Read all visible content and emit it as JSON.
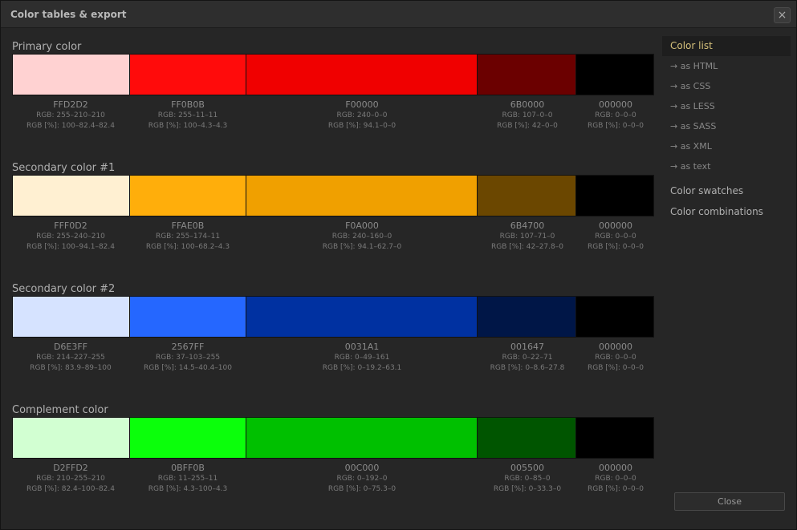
{
  "window": {
    "title": "Color tables & export",
    "close_icon": "×"
  },
  "sections": [
    {
      "title": "Primary color",
      "swatches": [
        {
          "color": "#FFD2D2",
          "hex": "FFD2D2",
          "rgb": "RGB: 255–210–210",
          "rgbp": "RGB [%]: 100–82.4–82.4"
        },
        {
          "color": "#FF0B0B",
          "hex": "FF0B0B",
          "rgb": "RGB: 255–11–11",
          "rgbp": "RGB [%]: 100–4.3–4.3"
        },
        {
          "color": "#F00000",
          "hex": "F00000",
          "rgb": "RGB: 240–0–0",
          "rgbp": "RGB [%]: 94.1–0–0"
        },
        {
          "color": "#6B0000",
          "hex": "6B0000",
          "rgb": "RGB: 107–0–0",
          "rgbp": "RGB [%]: 42–0–0"
        },
        {
          "color": "#000000",
          "hex": "000000",
          "rgb": "RGB: 0–0–0",
          "rgbp": "RGB [%]: 0–0–0"
        }
      ]
    },
    {
      "title": "Secondary color #1",
      "swatches": [
        {
          "color": "#FFF0D2",
          "hex": "FFF0D2",
          "rgb": "RGB: 255–240–210",
          "rgbp": "RGB [%]: 100–94.1–82.4"
        },
        {
          "color": "#FFAE0B",
          "hex": "FFAE0B",
          "rgb": "RGB: 255–174–11",
          "rgbp": "RGB [%]: 100–68.2–4.3"
        },
        {
          "color": "#F0A000",
          "hex": "F0A000",
          "rgb": "RGB: 240–160–0",
          "rgbp": "RGB [%]: 94.1–62.7–0"
        },
        {
          "color": "#6B4700",
          "hex": "6B4700",
          "rgb": "RGB: 107–71–0",
          "rgbp": "RGB [%]: 42–27.8–0"
        },
        {
          "color": "#000000",
          "hex": "000000",
          "rgb": "RGB: 0–0–0",
          "rgbp": "RGB [%]: 0–0–0"
        }
      ]
    },
    {
      "title": "Secondary color #2",
      "swatches": [
        {
          "color": "#D6E3FF",
          "hex": "D6E3FF",
          "rgb": "RGB: 214–227–255",
          "rgbp": "RGB [%]: 83.9–89–100"
        },
        {
          "color": "#2567FF",
          "hex": "2567FF",
          "rgb": "RGB: 37–103–255",
          "rgbp": "RGB [%]: 14.5–40.4–100"
        },
        {
          "color": "#0031A1",
          "hex": "0031A1",
          "rgb": "RGB: 0–49–161",
          "rgbp": "RGB [%]: 0–19.2–63.1"
        },
        {
          "color": "#001647",
          "hex": "001647",
          "rgb": "RGB: 0–22–71",
          "rgbp": "RGB [%]: 0–8.6–27.8"
        },
        {
          "color": "#000000",
          "hex": "000000",
          "rgb": "RGB: 0–0–0",
          "rgbp": "RGB [%]: 0–0–0"
        }
      ]
    },
    {
      "title": "Complement color",
      "swatches": [
        {
          "color": "#D2FFD2",
          "hex": "D2FFD2",
          "rgb": "RGB: 210–255–210",
          "rgbp": "RGB [%]: 82.4–100–82.4"
        },
        {
          "color": "#0BFF0B",
          "hex": "0BFF0B",
          "rgb": "RGB: 11–255–11",
          "rgbp": "RGB [%]: 4.3–100–4.3"
        },
        {
          "color": "#00C000",
          "hex": "00C000",
          "rgb": "RGB: 0–192–0",
          "rgbp": "RGB [%]: 0–75.3–0"
        },
        {
          "color": "#005500",
          "hex": "005500",
          "rgb": "RGB: 0–85–0",
          "rgbp": "RGB [%]: 0–33.3–0"
        },
        {
          "color": "#000000",
          "hex": "000000",
          "rgb": "RGB: 0–0–0",
          "rgbp": "RGB [%]: 0–0–0"
        }
      ]
    }
  ],
  "sidebar": {
    "color_list": "Color list",
    "exports": [
      "→ as HTML",
      "→ as CSS",
      "→ as LESS",
      "→ as SASS",
      "→ as XML",
      "→ as text"
    ],
    "color_swatches": "Color swatches",
    "color_combinations": "Color combinations"
  },
  "footer": {
    "close_label": "Close"
  },
  "theme": {
    "accent": "#d4c07a",
    "background": "#262626"
  }
}
